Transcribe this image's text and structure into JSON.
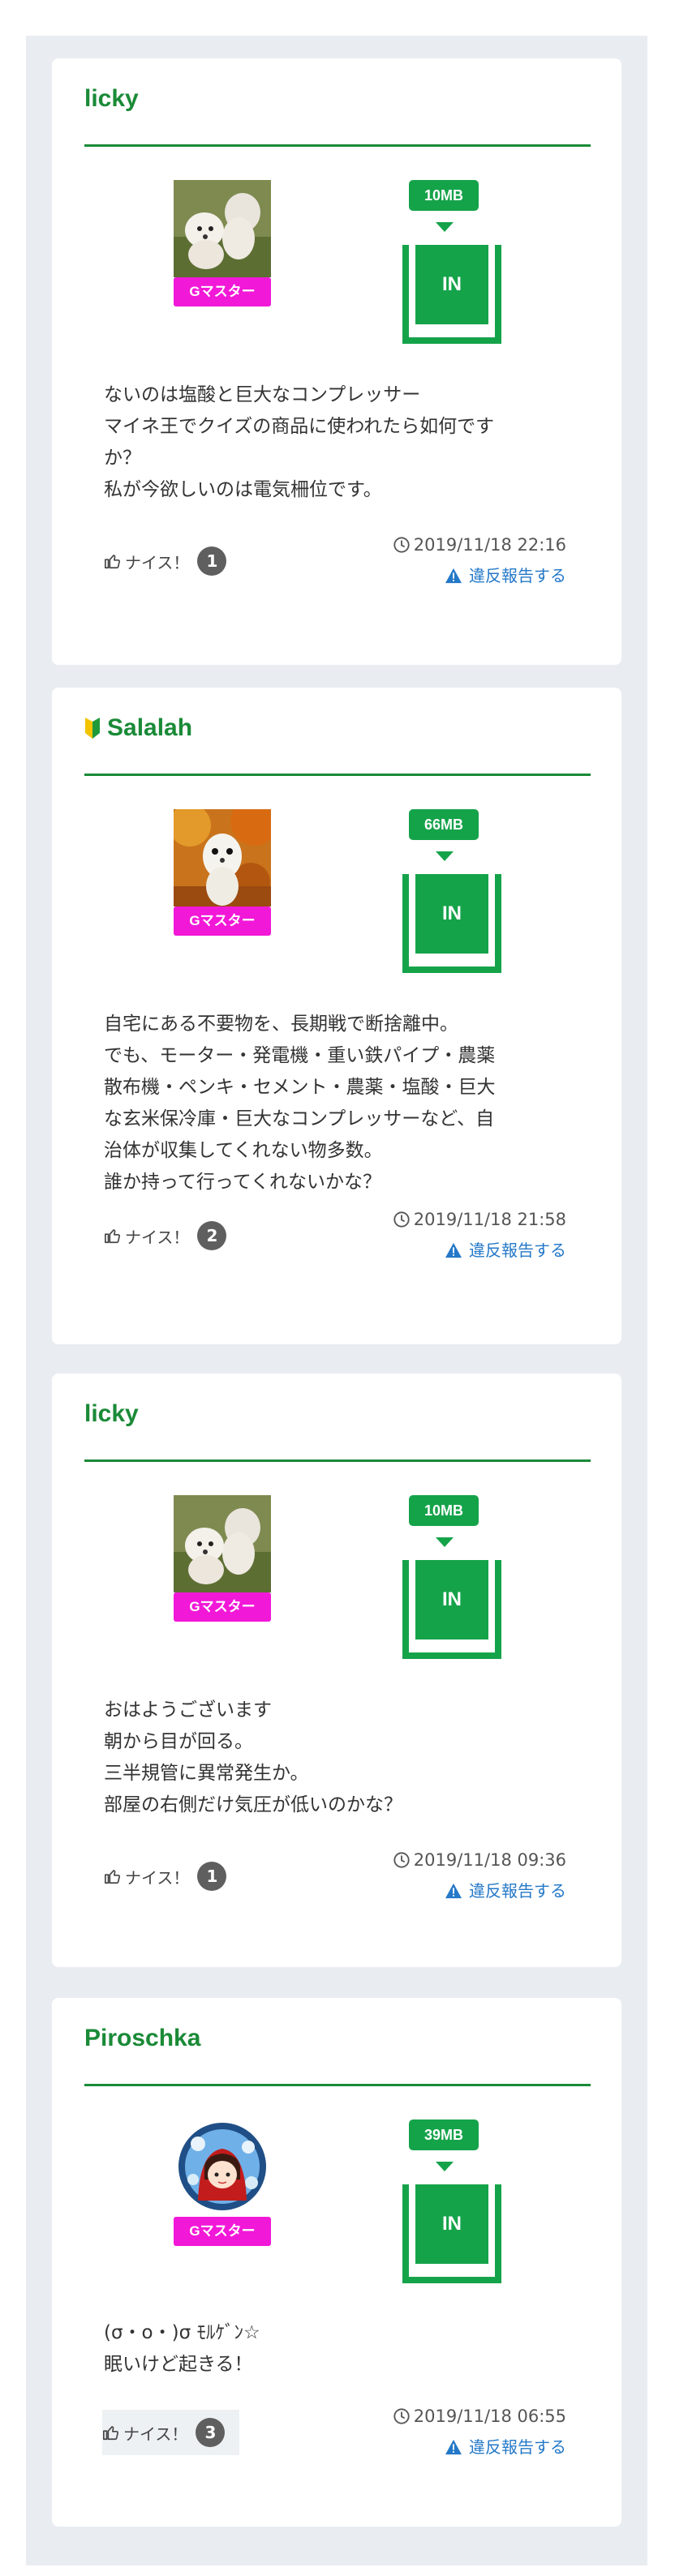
{
  "posts": [
    {
      "username": "licky",
      "beginner": false,
      "avatar": "poodle-photo",
      "badge": "Gマスター",
      "size": "10MB",
      "direction": "IN",
      "lines": [
        "ないのは塩酸と巨大なコンプレッサー",
        "マイネ王でクイズの商品に使われたら如何です",
        "か？",
        "私が今欲しいのは電気柵位です。"
      ],
      "nice_label": "ナイス！",
      "nice_count": "1",
      "date": "2019/11/18 22:16",
      "report": "違反報告する"
    },
    {
      "username": "Salalah",
      "beginner": true,
      "avatar": "ferret-photo",
      "badge": "Gマスター",
      "size": "66MB",
      "direction": "IN",
      "lines": [
        "自宅にある不要物を、長期戦で断捨離中。",
        "でも、モーター・発電機・重い鉄パイプ・農薬",
        "散布機・ペンキ・セメント・農薬・塩酸・巨大",
        "な玄米保冷庫・巨大なコンプレッサーなど、自",
        "治体が収集してくれない物多数。",
        "誰か持って行ってくれないかな？"
      ],
      "nice_label": "ナイス！",
      "nice_count": "2",
      "date": "2019/11/18 21:58",
      "report": "違反報告する"
    },
    {
      "username": "licky",
      "beginner": false,
      "avatar": "poodle-photo",
      "badge": "Gマスター",
      "size": "10MB",
      "direction": "IN",
      "lines": [
        "おはようございます",
        "朝から目が回る。",
        "三半規管に異常発生か。",
        "部屋の右側だけ気圧が低いのかな？"
      ],
      "nice_label": "ナイス！",
      "nice_count": "1",
      "date": "2019/11/18 09:36",
      "report": "違反報告する"
    },
    {
      "username": "Piroschka",
      "beginner": false,
      "avatar": "red-hood-girl-illustration",
      "badge": "Gマスター",
      "size": "39MB",
      "direction": "IN",
      "lines": [
        "(σ・o・)σ ﾓﾙｹﾞﾝ☆",
        "眠いけど起きる！"
      ],
      "nice_label": "ナイス！",
      "nice_count": "3",
      "date": "2019/11/18 06:55",
      "report": "違反報告する"
    }
  ],
  "colors": {
    "username": "#1a8a37",
    "badge": "#f218d8",
    "size": "#15a34a",
    "report": "#2478c8",
    "background": "#e9edf1"
  },
  "icons": {
    "nice": "thumbs-up-icon",
    "date": "clock-icon",
    "report": "warning-triangle-icon",
    "beginner": "beginner-mark-icon"
  }
}
